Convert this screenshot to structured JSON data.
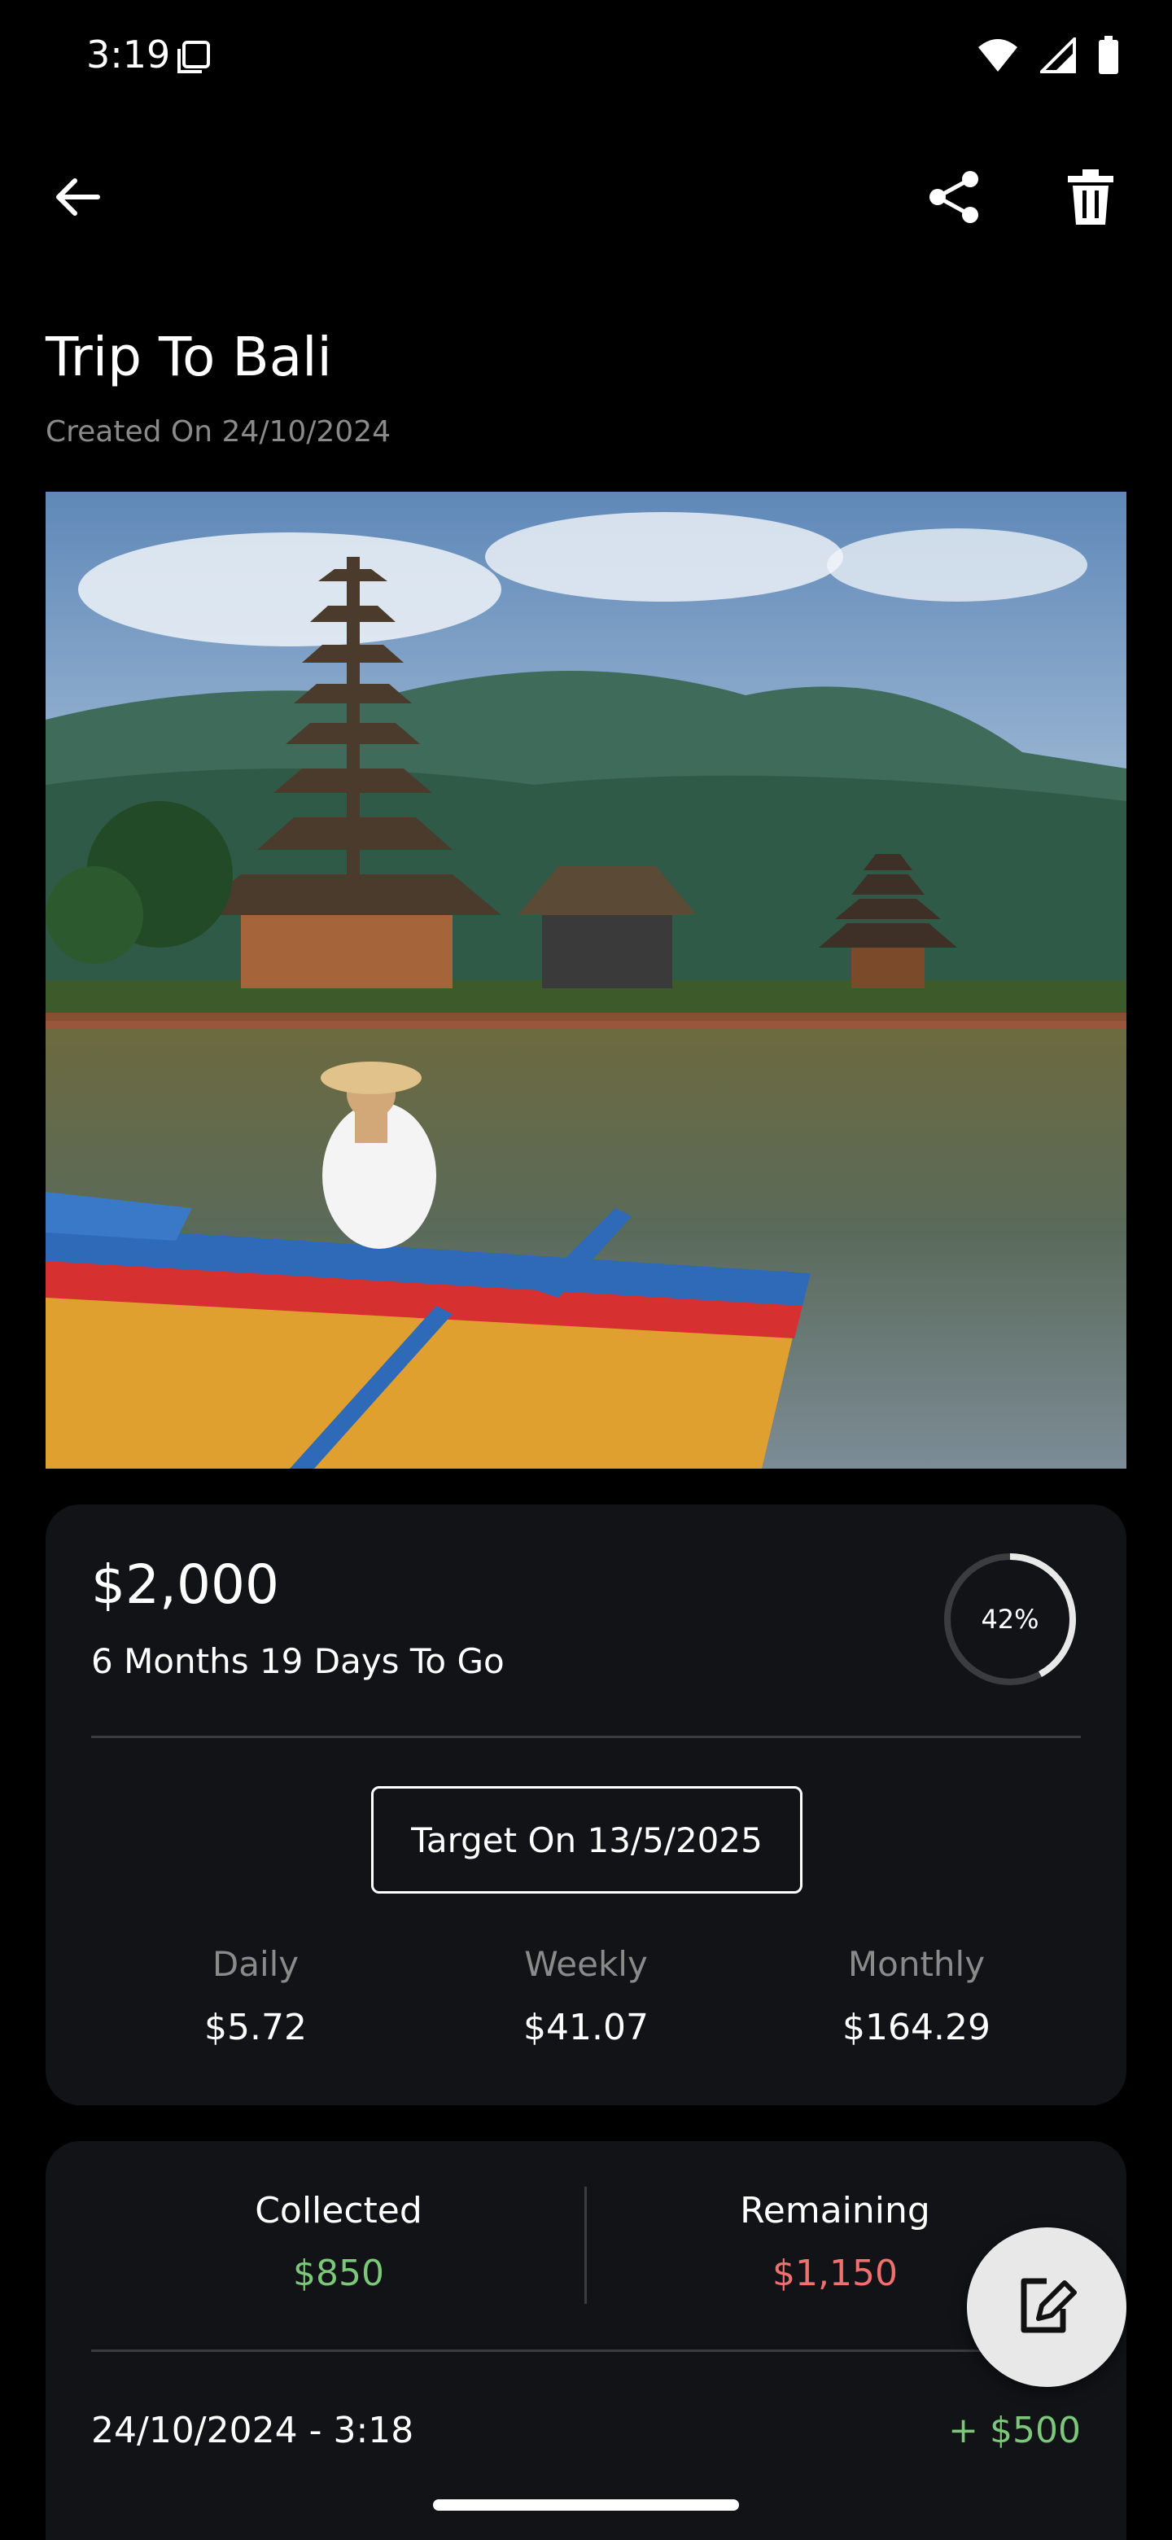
{
  "status_bar": {
    "time": "3:19",
    "icons": [
      "screenshot-icon",
      "wifi-icon",
      "signal-icon",
      "battery-icon"
    ]
  },
  "app_bar": {
    "icons": [
      "back-arrow-icon",
      "share-icon",
      "trash-icon"
    ]
  },
  "goal": {
    "title": "Trip To Bali",
    "created": "Created On 24/10/2024",
    "amount": "$2,000",
    "time_left": "6 Months 19 Days To Go",
    "progress_percent": 42,
    "progress_label": "42%",
    "target_button": "Target On 13/5/2025"
  },
  "rates": [
    {
      "label": "Daily",
      "value": "$5.72"
    },
    {
      "label": "Weekly",
      "value": "$41.07"
    },
    {
      "label": "Monthly",
      "value": "$164.29"
    }
  ],
  "summary": {
    "collected_label": "Collected",
    "collected_value": "$850",
    "remaining_label": "Remaining",
    "remaining_value": "$1,150"
  },
  "history": [
    {
      "date": "24/10/2024 - 3:18",
      "amount": "+ $500"
    }
  ],
  "fab": {
    "icon": "edit-note-icon"
  },
  "colors": {
    "background": "#000000",
    "card": "#111317",
    "positive": "#7cc77a",
    "negative": "#f07070",
    "muted": "#8a8a8a"
  }
}
